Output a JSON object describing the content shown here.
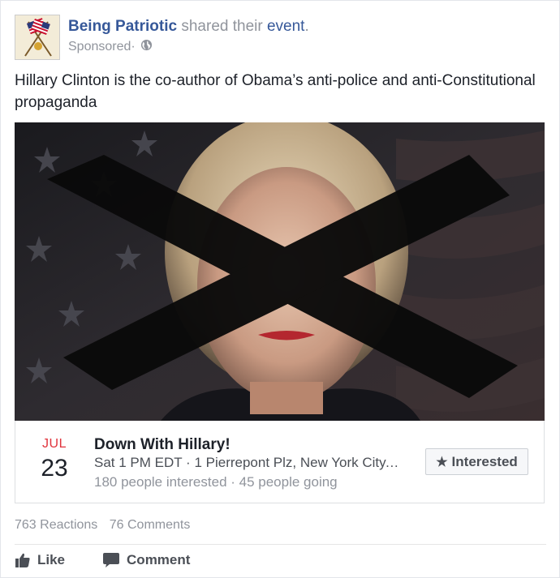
{
  "header": {
    "page_name": "Being Patriotic",
    "shared_text": " shared their ",
    "event_link": "event",
    "period": ".",
    "sponsored": "Sponsored",
    "separator": " · "
  },
  "post": {
    "text": "Hillary Clinton is the co-author of Obama’s anti-police and anti-Constitutional propaganda"
  },
  "event": {
    "month": "JUL",
    "day": "23",
    "title": "Down With Hillary!",
    "meta": "Sat 1 PM EDT · 1 Pierrepont Plz, New York City, ...",
    "stats": "180 people interested · 45 people going",
    "interested_label": "Interested"
  },
  "engagement": {
    "reactions": "763 Reactions",
    "comments": "76 Comments"
  },
  "actions": {
    "like_label": "Like",
    "comment_label": "Comment"
  },
  "icons": {
    "avatar": "crossed-flags-icon",
    "globe": "globe-icon",
    "star": "star-icon",
    "like": "thumbs-up-icon",
    "comment": "comment-bubble-icon"
  },
  "colors": {
    "link_blue": "#365899",
    "date_red": "#e0333c",
    "muted_gray": "#90949c"
  }
}
